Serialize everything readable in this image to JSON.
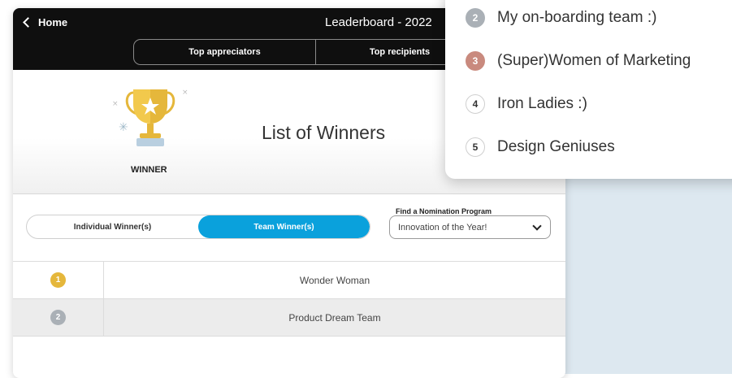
{
  "header": {
    "back_label": "Home",
    "title": "Leaderboard - 2022",
    "tabs": [
      {
        "label": "Top appreciators"
      },
      {
        "label": "Top recipients"
      }
    ]
  },
  "hero": {
    "badge_label": "WINNER",
    "title": "List of Winners"
  },
  "filter": {
    "options": [
      {
        "label": "Individual Winner(s)",
        "active": false
      },
      {
        "label": "Team Winner(s)",
        "active": true
      }
    ],
    "program_label": "Find a Nomination Program",
    "program_value": "Innovation of the Year!"
  },
  "winners": [
    {
      "rank": "1",
      "name": "Wonder Woman",
      "color": "#e5b73b"
    },
    {
      "rank": "2",
      "name": "Product Dream Team",
      "color": "#aab0b6"
    }
  ],
  "popup": {
    "items": [
      {
        "rank": "2",
        "name": "My on-boarding team :)",
        "style": "silver"
      },
      {
        "rank": "3",
        "name": "(Super)Women of Marketing",
        "style": "bronze"
      },
      {
        "rank": "4",
        "name": "Iron Ladies :)",
        "style": "plain"
      },
      {
        "rank": "5",
        "name": "Design Geniuses",
        "style": "plain"
      }
    ]
  },
  "colors": {
    "accent": "#0aa1dc",
    "header_bg": "#0f0f0f",
    "gold": "#e5b73b",
    "silver": "#aab0b6",
    "bronze": "#c98a7e"
  }
}
